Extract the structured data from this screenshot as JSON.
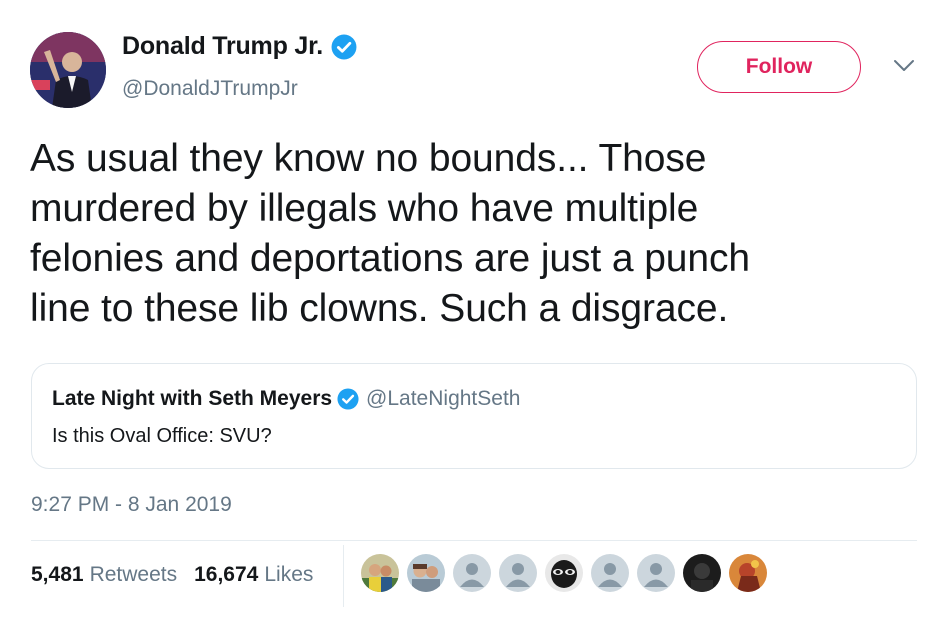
{
  "author": {
    "display_name": "Donald Trump Jr.",
    "handle": "@DonaldJTrumpJr",
    "verified": true,
    "avatar_icon": "profile-photo"
  },
  "follow_label": "Follow",
  "menu_icon": "chevron-down-icon",
  "tweet_lines": [
    "As usual they know no bounds... Those",
    "murdered by illegals who have multiple",
    "felonies and deportations are just a punch",
    "line to these lib clowns. Such a disgrace."
  ],
  "quoted": {
    "display_name": "Late Night with Seth Meyers",
    "handle": "@LateNightSeth",
    "verified": true,
    "text": "Is this Oval Office: SVU?"
  },
  "timestamp": "9:27 PM - 8 Jan 2019",
  "stats": {
    "retweets_count": "5,481",
    "retweets_label": "Retweets",
    "likes_count": "16,674",
    "likes_label": "Likes"
  },
  "likers": [
    {
      "kind": "photo-a"
    },
    {
      "kind": "photo-b"
    },
    {
      "kind": "default"
    },
    {
      "kind": "default"
    },
    {
      "kind": "masked"
    },
    {
      "kind": "default"
    },
    {
      "kind": "default"
    },
    {
      "kind": "dark"
    },
    {
      "kind": "orange"
    }
  ],
  "colors": {
    "accent": "#e0245e",
    "verified": "#1da1f2",
    "muted": "#657786",
    "text": "#14171a",
    "border": "#e1e8ed"
  }
}
